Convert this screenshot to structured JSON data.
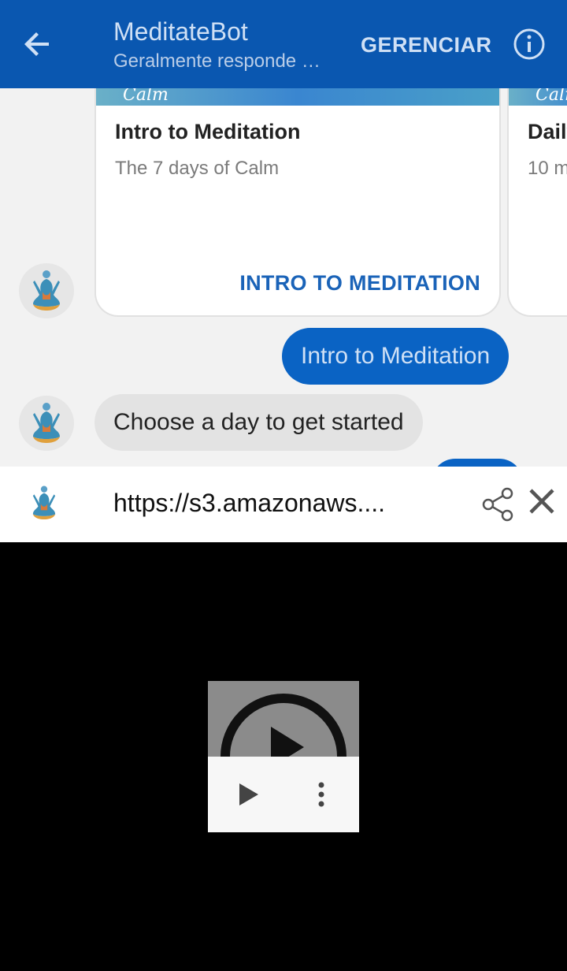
{
  "appbar": {
    "title": "MeditateBot",
    "subtitle": "Geralmente responde n...",
    "manage_label": "GERENCIAR"
  },
  "chat": {
    "cards": [
      {
        "logo": "Calm",
        "title": "Intro to Meditation",
        "subtitle": "The 7 days of Calm",
        "cta": "INTRO TO MEDITATION"
      },
      {
        "logo": "Calm",
        "title": "Daily",
        "subtitle": "10 m"
      }
    ],
    "outgoing_message": "Intro to Meditation",
    "incoming_message": "Choose a day to get started"
  },
  "browser": {
    "url": "https://s3.amazonaws...."
  },
  "colors": {
    "appbar": "#0a57b0",
    "accent": "#1a63b8",
    "bubble_out": "#0a63c4"
  },
  "icons": [
    "back-arrow-icon",
    "info-icon",
    "meditation-avatar-icon",
    "share-icon",
    "close-icon",
    "play-icon",
    "more-vert-icon",
    "play-circle-icon"
  ]
}
